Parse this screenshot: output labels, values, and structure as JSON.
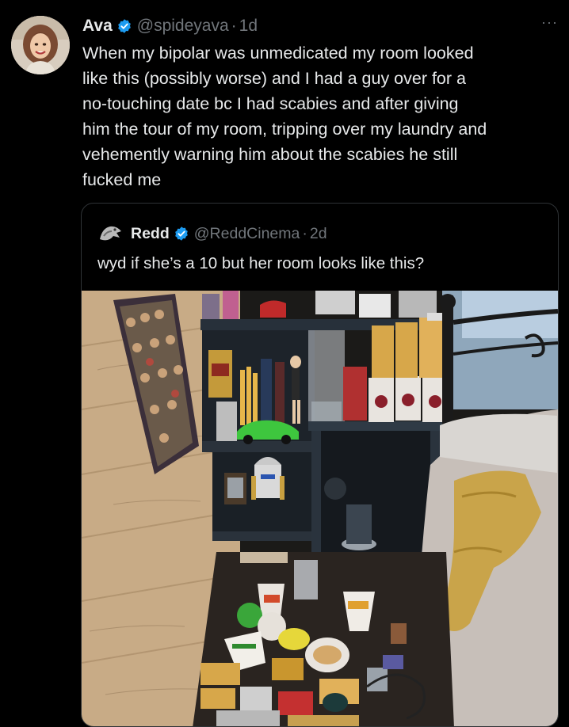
{
  "tweet": {
    "display_name": "Ava",
    "handle": "@spideyava",
    "separator": "·",
    "time": "1d",
    "more_label": "···",
    "text": "When my bipolar was unmedicated my room looked\nlike this (possibly worse) and I had a guy over for a\nno-touching date bc I had scabies and after giving\nhim the tour of my room, tripping over my laundry and\nvehemently warning him about the scabies he still\nfucked me"
  },
  "quote": {
    "display_name": "Redd",
    "handle": "@ReddCinema",
    "separator": "·",
    "time": "2d",
    "text": "wyd if she’s a 10 but her room looks like this?"
  },
  "colors": {
    "background": "#000000",
    "primary_text": "#e7e9ea",
    "secondary_text": "#71767b",
    "border": "#2f3336",
    "verified_blue": "#1d9bf0"
  },
  "icons": {
    "verified": "verified-badge-icon",
    "more": "more-options-icon"
  }
}
